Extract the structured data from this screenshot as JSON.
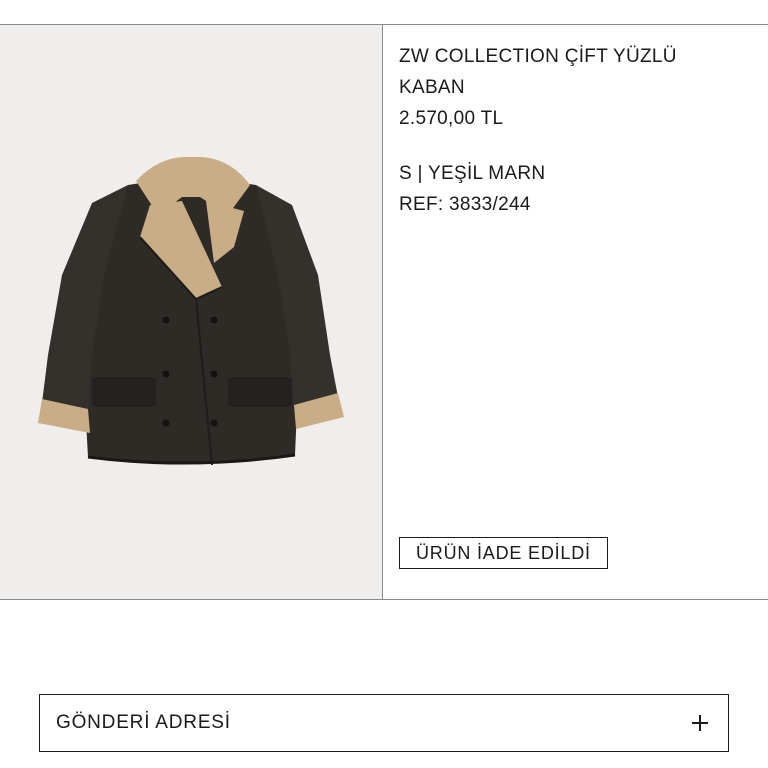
{
  "product": {
    "image_alt": "coat-product-image",
    "title": "ZW COLLECTION ÇİFT YÜZLÜ KABAN",
    "price": "2.570,00 TL",
    "variant": "S | YEŞİL MARN",
    "ref": "REF: 3833/244",
    "status": "ÜRÜN İADE EDİLDİ"
  },
  "shipping": {
    "label": "GÖNDERİ ADRESİ",
    "icon": "plus-icon"
  },
  "colors": {
    "image_background": "#efeeec",
    "coat": "#2e2b27",
    "shearling": "#c9ad86",
    "border": "#8a8a8a",
    "text": "#1a1a1a"
  }
}
